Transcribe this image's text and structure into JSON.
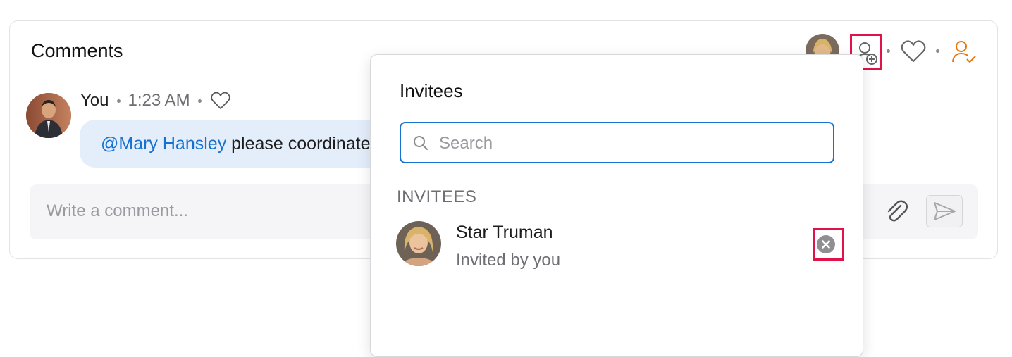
{
  "card": {
    "title": "Comments"
  },
  "comment": {
    "author": "You",
    "time": "1:23 AM",
    "mention": "@Mary Hansley",
    "text": " please coordinate"
  },
  "composer": {
    "placeholder": "Write a comment..."
  },
  "popover": {
    "title": "Invitees",
    "search_placeholder": "Search",
    "section_label": "INVITEES",
    "invitees": [
      {
        "name": "Star Truman",
        "subtitle": "Invited by you"
      }
    ]
  },
  "colors": {
    "accent": "#1672d0",
    "highlight": "#e0124a",
    "assigned_icon": "#e8760f",
    "bubble": "#e4eefb"
  },
  "icons": {
    "add_invitee": "add-person-icon",
    "like": "heart-icon",
    "assigned": "person-check-icon",
    "search": "search-icon",
    "attach": "paperclip-icon",
    "send": "send-icon",
    "remove": "close-circle-icon"
  }
}
